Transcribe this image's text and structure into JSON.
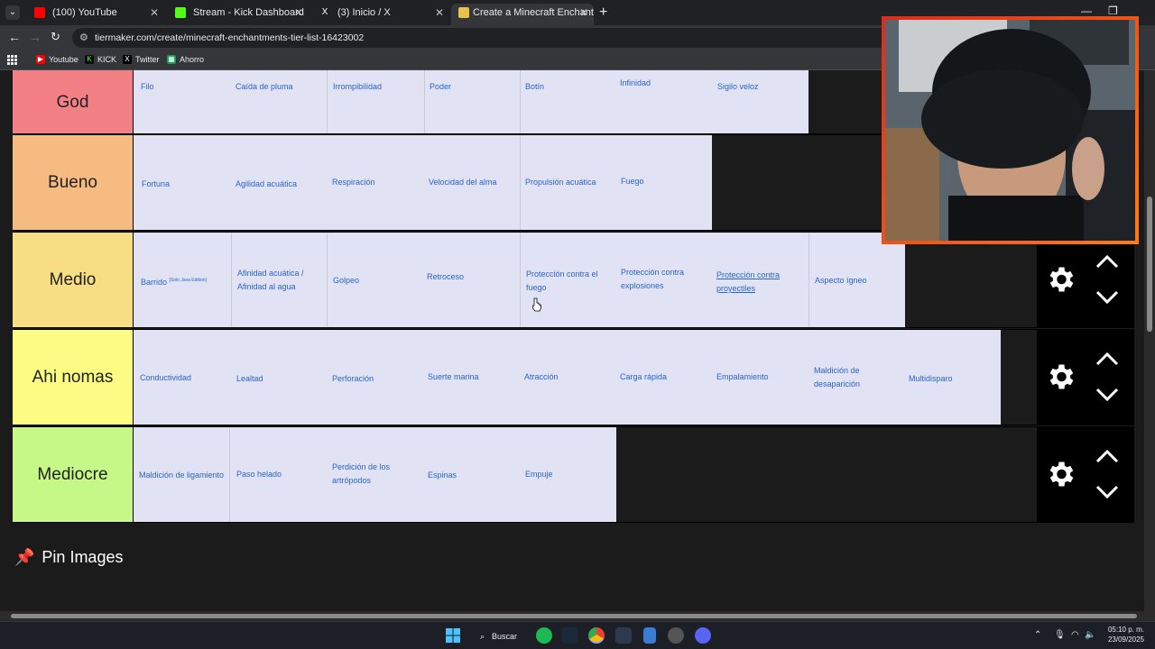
{
  "tabs": [
    {
      "title": "(100) YouTube",
      "color": "#ff0000"
    },
    {
      "title": "Stream - Kick Dashboard",
      "color": "#53fc18"
    },
    {
      "title": "(3) Inicio / X",
      "color": "#ffffff"
    },
    {
      "title": "Create a Minecraft Enchantme",
      "color": "#e8c34a"
    }
  ],
  "address": {
    "url": "tiermaker.com/create/minecraft-enchantments-tier-list-16423002"
  },
  "bookmarks": [
    {
      "label": "Youtube",
      "color": "#ff0000"
    },
    {
      "label": "KICK",
      "color": "#53fc18"
    },
    {
      "label": "Twitter",
      "color": "#000000"
    },
    {
      "label": "Ahorro",
      "color": "#0f9d58"
    }
  ],
  "tiers": [
    {
      "label": "God",
      "color": "#f28085",
      "items": [
        "Filo",
        "Caída de pluma",
        "Irrompibilidad",
        "Poder",
        "Botín",
        "Infinidad",
        "Sigilo veloz"
      ]
    },
    {
      "label": "Bueno",
      "color": "#f6bb81",
      "items": [
        "Fortuna",
        "Agilidad acuática",
        "Respiración",
        "Velocidad del alma",
        "Propulsión acuática",
        "Fuego"
      ]
    },
    {
      "label": "Medio",
      "color": "#f8de82",
      "items": [
        "Barrido",
        "Afinidad acuática / Afinidad al agua",
        "Golpeo",
        "Retroceso",
        "Protección contra el fuego",
        "Protección contra explosiones",
        "Protección contra proyectiles",
        "Aspecto ígneo"
      ],
      "note": "[Solo Java Edition]"
    },
    {
      "label": "Ahi nomas",
      "color": "#fcfb84",
      "items": [
        "Conductividad",
        "Lealtad",
        "Perforación",
        "Suerte marina",
        "Atracción",
        "Carga rápida",
        "Empalamiento",
        "Maldición de desaparición",
        "Multidisparo"
      ]
    },
    {
      "label": "Mediocre",
      "color": "#c5f886",
      "items": [
        "Maldición de ligamiento",
        "Paso helado",
        "Perdición de los artrópodos",
        "Espinas",
        "Empuje"
      ]
    }
  ],
  "pin_section": {
    "title": "Pin Images"
  },
  "taskbar": {
    "search_label": "Buscar",
    "time": "05:10 p. m.",
    "date": "23/09/2025"
  }
}
